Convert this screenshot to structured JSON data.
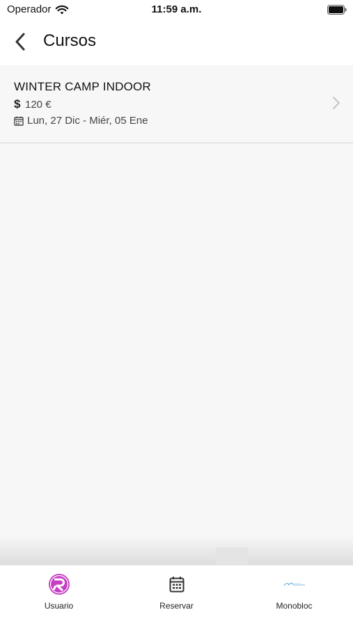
{
  "status_bar": {
    "carrier": "Operador",
    "time": "11:59 a.m."
  },
  "nav": {
    "title": "Cursos",
    "back_icon": "chevron-left-icon"
  },
  "courses": [
    {
      "name": "WINTER CAMP INDOOR",
      "price_symbol": "$",
      "price": "120 €",
      "dates": "Lun, 27 Dic - Miér, 05 Ene"
    }
  ],
  "tabs": [
    {
      "label": "Usuario",
      "icon": "user-logo-icon"
    },
    {
      "label": "Reservar",
      "icon": "calendar-icon"
    },
    {
      "label": "Monobloc",
      "icon": "monobloc-logo-icon"
    }
  ],
  "colors": {
    "accent": "#c63fc3",
    "background": "#f7f7f7",
    "bar": "#ffffff"
  }
}
